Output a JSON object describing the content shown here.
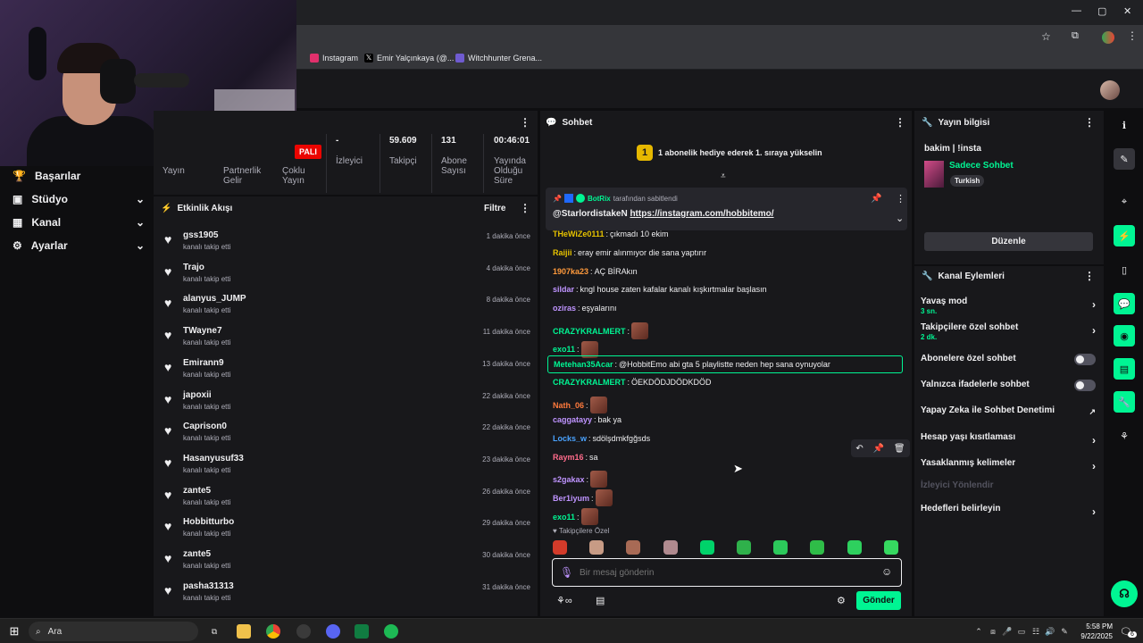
{
  "browser": {
    "bookmarks": [
      {
        "label": "Instagram",
        "color": "#e1306c"
      },
      {
        "label": "Emir Yalçınkaya (@...",
        "color": "#000000"
      },
      {
        "label": "Witchhunter Grena...",
        "color": "#6f5bd0"
      }
    ],
    "window_buttons": [
      "—",
      "▢",
      "✕"
    ]
  },
  "left_nav": {
    "items": [
      {
        "label": "Başarılar",
        "icon": "trophy-icon",
        "chevron": false
      },
      {
        "label": "Stüdyo",
        "icon": "studio-icon",
        "chevron": true
      },
      {
        "label": "Kanal",
        "icon": "channel-icon",
        "chevron": true
      },
      {
        "label": "Ayarlar",
        "icon": "gear-icon",
        "chevron": true
      }
    ]
  },
  "stats": {
    "badge": "PALI",
    "items": [
      {
        "value": "",
        "label": "Yayın"
      },
      {
        "value": "",
        "label": "Partnerlik Gelir"
      },
      {
        "value": "",
        "label": "Çoklu Yayın"
      },
      {
        "value": "-",
        "label": "İzleyici"
      },
      {
        "value": "59.609",
        "label": "Takipçi"
      },
      {
        "value": "131",
        "label": "Abone Sayısı"
      },
      {
        "value": "00:46:01",
        "label": "Yayında Olduğu Süre"
      }
    ]
  },
  "activity": {
    "title": "Etkinlik Akışı",
    "filter_label": "Filtre",
    "entries": [
      {
        "name": "gss1905",
        "action": "kanalı takip etti",
        "time": "1 dakika önce"
      },
      {
        "name": "Trajo",
        "action": "kanalı takip etti",
        "time": "4 dakika önce"
      },
      {
        "name": "alanyus_JUMP",
        "action": "kanalı takip etti",
        "time": "8 dakika önce"
      },
      {
        "name": "TWayne7",
        "action": "kanalı takip etti",
        "time": "11 dakika önce"
      },
      {
        "name": "Emirann9",
        "action": "kanalı takip etti",
        "time": "13 dakika önce"
      },
      {
        "name": "japoxii",
        "action": "kanalı takip etti",
        "time": "22 dakika önce"
      },
      {
        "name": "Caprison0",
        "action": "kanalı takip etti",
        "time": "22 dakika önce"
      },
      {
        "name": "Hasanyusuf33",
        "action": "kanalı takip etti",
        "time": "23 dakika önce"
      },
      {
        "name": "zante5",
        "action": "kanalı takip etti",
        "time": "26 dakika önce"
      },
      {
        "name": "Hobbitturbo",
        "action": "kanalı takip etti",
        "time": "29 dakika önce"
      },
      {
        "name": "zante5",
        "action": "kanalı takip etti",
        "time": "30 dakika önce"
      },
      {
        "name": "pasha31313",
        "action": "kanalı takip etti",
        "time": "31 dakika önce"
      }
    ]
  },
  "chat": {
    "title": "Sohbet",
    "gift_banner": "1 abonelik hediye ederek 1. sıraya yükselin",
    "gift_rank": "1",
    "pinned": {
      "by_user": "BotRix",
      "by_suffix": "tarafından sabitlendi",
      "mention": "@StarlordistakeN",
      "link": "https://instagram.com/hobbitemo/"
    },
    "messages": [
      {
        "user": "THeWiZe0111",
        "color": "#e6c200",
        "text": "çıkmadı 10 ekim",
        "emote": false
      },
      {
        "user": "Raijii",
        "color": "#e6c200",
        "text": "eray emir alınmıyor die sana yaptırır",
        "emote": false
      },
      {
        "user": "1907ka23",
        "color": "#ff9a3c",
        "text": "AÇ BİRAkın",
        "emote": false
      },
      {
        "user": "sildar",
        "color": "#bf94ff",
        "text": "kngl house zaten kafalar kanalı kışkırtmalar başlasın",
        "emote": false
      },
      {
        "user": "oziras",
        "color": "#bf94ff",
        "text": "eşyalarını",
        "emote": false
      },
      {
        "user": "CRAZYKRALMERT",
        "color": "#00f593",
        "text": "",
        "emote": true
      },
      {
        "user": "exo11",
        "color": "#00f593",
        "text": "",
        "emote": true
      },
      {
        "user": "Metehan35Acar",
        "color": "#00f593",
        "text": "@HobbitEmo abi gta 5 playlistte neden hep sana oynuyolar",
        "emote": false
      },
      {
        "user": "CRAZYKRALMERT",
        "color": "#00f593",
        "text": "ÖEKDÖDJDÖDKDÖD",
        "emote": false
      },
      {
        "user": "Nath_06",
        "color": "#ff7a3c",
        "text": "",
        "emote": true
      },
      {
        "user": "caggatayy",
        "color": "#bf94ff",
        "text": "bak ya",
        "emote": false
      },
      {
        "user": "Locks_w",
        "color": "#4aa3ff",
        "text": "sdölşdmkfgğsds",
        "emote": false
      },
      {
        "user": "Raym16",
        "color": "#ff6b8b",
        "text": "sa",
        "emote": false
      },
      {
        "user": "s2gakax",
        "color": "#bf94ff",
        "text": "",
        "emote": true
      },
      {
        "user": "Ber1iyum",
        "color": "#bf94ff",
        "text": "",
        "emote": true
      },
      {
        "user": "exo11",
        "color": "#00f593",
        "text": "",
        "emote": true
      }
    ],
    "followers_only_label": "Takipçilere Özel",
    "input_placeholder": "Bir mesaj gönderin",
    "send_label": "Gönder"
  },
  "stream_info": {
    "title": "Yayın bilgisi",
    "stream_title": "bakim | !insta",
    "category": "Sadece Sohbet",
    "tag": "Turkish",
    "edit_label": "Düzenle"
  },
  "channel_actions": {
    "title": "Kanal Eylemleri",
    "items": [
      {
        "label": "Yavaş mod",
        "sub": "3 sn.",
        "control": "chevron"
      },
      {
        "label": "Takipçilere özel sohbet",
        "sub": "2 dk.",
        "control": "chevron"
      },
      {
        "label": "Abonelere özel sohbet",
        "sub": "",
        "control": "toggle"
      },
      {
        "label": "Yalnızca ifadelerle sohbet",
        "sub": "",
        "control": "toggle"
      },
      {
        "label": "Yapay Zeka ile Sohbet Denetimi",
        "sub": "",
        "control": "external"
      },
      {
        "label": "Hesap yaşı kısıtlaması",
        "sub": "",
        "control": "chevron"
      },
      {
        "label": "Yasaklanmış kelimeler",
        "sub": "",
        "control": "chevron"
      },
      {
        "label": "İzleyici Yönlendir",
        "sub": "",
        "control": "disabled"
      },
      {
        "label": "Hedefleri belirleyin",
        "sub": "",
        "control": "chevron"
      }
    ]
  },
  "taskbar": {
    "search_label": "Ara",
    "time": "5:58 PM",
    "date": "9/22/2025",
    "notification_count": "6"
  },
  "colors": {
    "accent": "#00f593",
    "bg": "#0e0e10",
    "panel": "#18181b",
    "live": "#eb0400"
  }
}
